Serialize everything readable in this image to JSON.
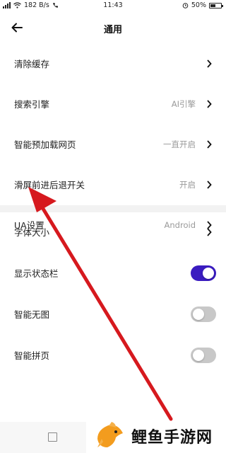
{
  "status_bar": {
    "signal_label": "4G",
    "speed": "182 B/s",
    "time": "11:43",
    "battery": "50%",
    "battery_level": 0.5
  },
  "header": {
    "title": "通用",
    "back_icon": "arrow-left-icon"
  },
  "settings": {
    "items": [
      {
        "label": "清除缓存",
        "value": ""
      },
      {
        "label": "搜索引擎",
        "value": "AI引擎"
      },
      {
        "label": "智能预加载网页",
        "value": "一直开启"
      },
      {
        "label": "滑屏前进后退开关",
        "value": "开启"
      },
      {
        "label": "UA设置",
        "value": "Android"
      }
    ],
    "items2": [
      {
        "label": "字体大小"
      },
      {
        "label": "显示状态栏",
        "toggle": true
      },
      {
        "label": "智能无图",
        "toggle": false
      },
      {
        "label": "智能拼页",
        "toggle": false
      }
    ]
  },
  "watermark": {
    "text": "鲤鱼手游网"
  },
  "colors": {
    "accent": "#3a1cc0",
    "arrow": "#d6191e",
    "toggle_off": "#c8c8c8"
  }
}
